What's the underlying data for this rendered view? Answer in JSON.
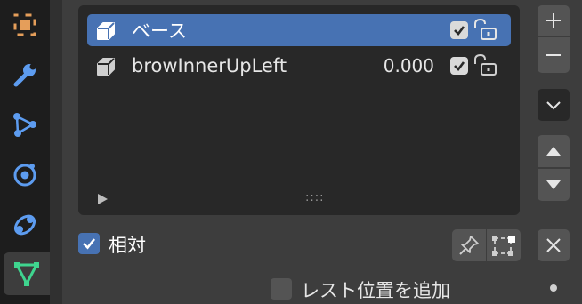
{
  "side_tabs": [
    {
      "name": "object-tab",
      "icon": "object-icon",
      "color": "#e59e5a"
    },
    {
      "name": "modifiers-tab",
      "icon": "wrench-icon",
      "color": "#5d9cf0"
    },
    {
      "name": "particles-tab",
      "icon": "particles-icon",
      "color": "#5d9cf0"
    },
    {
      "name": "physics-tab",
      "icon": "physics-icon",
      "color": "#5d9cf0"
    },
    {
      "name": "constraints-tab",
      "icon": "constraint-icon",
      "color": "#5d9cf0"
    },
    {
      "name": "data-tab",
      "icon": "mesh-data-icon",
      "color": "#3fd58f",
      "active": true
    }
  ],
  "shape_keys": {
    "items": [
      {
        "name": "ベース",
        "value": "",
        "selected": true,
        "checked": true
      },
      {
        "name": "browInnerUpLeft",
        "value": "0.000",
        "selected": false,
        "checked": true
      }
    ],
    "grip": "::::"
  },
  "relative": {
    "label": "相対",
    "checked": true
  },
  "rest_position": {
    "label": "レスト位置を追加",
    "checked": false
  },
  "colors": {
    "accent": "#4772b3",
    "active_tab_icon": "#3fd58f"
  }
}
